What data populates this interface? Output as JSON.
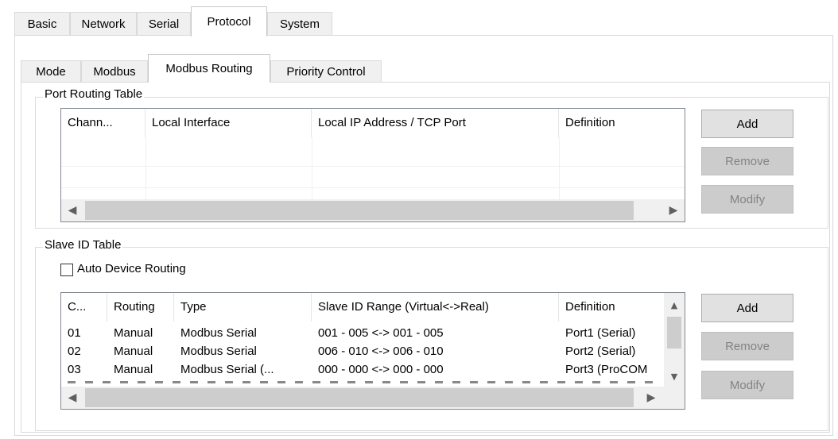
{
  "top_tabs": [
    "Basic",
    "Network",
    "Serial",
    "Protocol",
    "System"
  ],
  "top_tab_active": "Protocol",
  "sub_tabs": [
    "Mode",
    "Modbus",
    "Modbus Routing",
    "Priority Control"
  ],
  "sub_tab_active": "Modbus Routing",
  "port_routing": {
    "title": "Port Routing Table",
    "columns": [
      "Chann...",
      "Local Interface",
      "Local IP Address / TCP Port",
      "Definition"
    ],
    "rows": [],
    "buttons": {
      "add": "Add",
      "remove": "Remove",
      "modify": "Modify"
    },
    "buttons_enabled": {
      "add": true,
      "remove": false,
      "modify": false
    }
  },
  "slave_id": {
    "title": "Slave ID Table",
    "auto_device_routing": {
      "label": "Auto Device Routing",
      "checked": false
    },
    "columns": [
      "C...",
      "Routing",
      "Type",
      "Slave ID Range (Virtual<->Real)",
      "Definition"
    ],
    "rows": [
      [
        "01",
        "Manual",
        "Modbus Serial",
        "001 - 005 <-> 001 - 005",
        "Port1 (Serial)"
      ],
      [
        "02",
        "Manual",
        "Modbus Serial",
        "006 - 010 <-> 006 - 010",
        "Port2 (Serial)"
      ],
      [
        "03",
        "Manual",
        "Modbus Serial (...",
        "000 - 000 <-> 000 - 000",
        "Port3 (ProCOM"
      ]
    ],
    "buttons": {
      "add": "Add",
      "remove": "Remove",
      "modify": "Modify"
    },
    "buttons_enabled": {
      "add": true,
      "remove": false,
      "modify": false
    }
  },
  "icons": {
    "scroll_left": "◀",
    "scroll_right": "▶",
    "scroll_up": "▲",
    "scroll_down": "▼"
  }
}
